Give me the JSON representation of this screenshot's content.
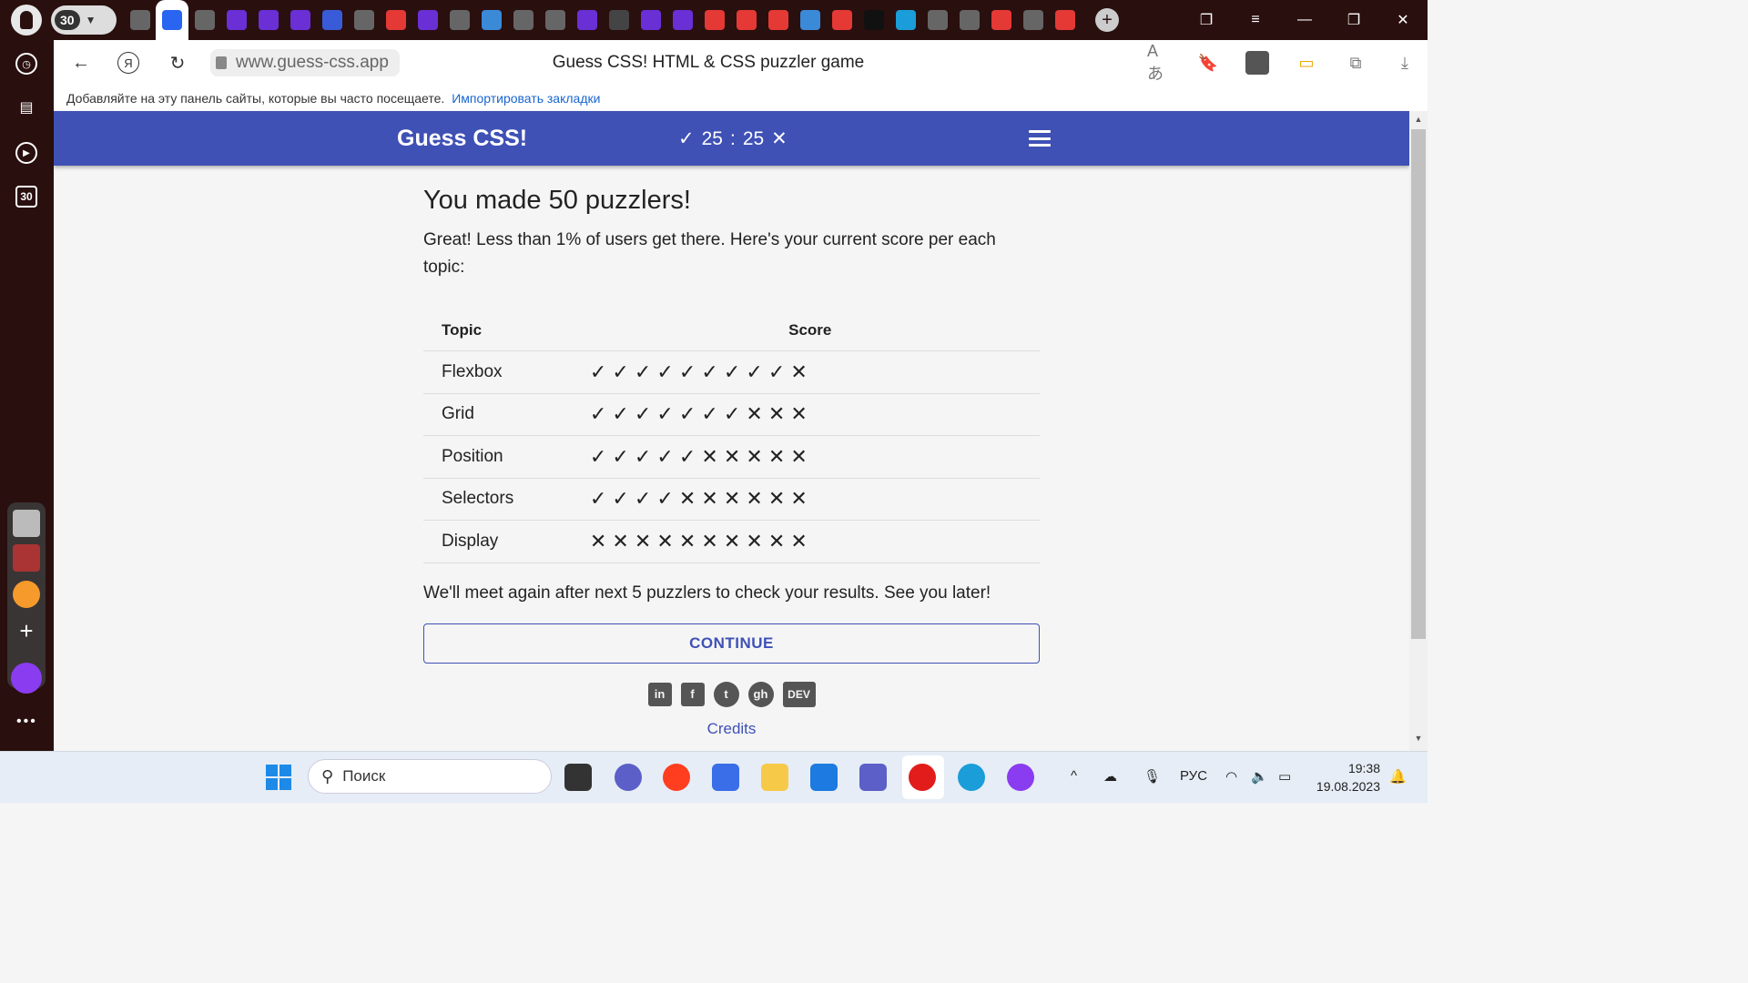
{
  "browser": {
    "tab_group_count": "30",
    "tab_icons": [
      "bookmark-tab-icon",
      "css3-tab-icon",
      "doc-tab-icon",
      "b-tab-icon",
      "b-tab-icon",
      "b-tab-icon",
      "network-tab-icon",
      "dash-tab-icon",
      "yandex-tab-icon",
      "b-tab-icon",
      "doc-tab-icon",
      "puzzle-tab-icon",
      "chart-tab-icon",
      "chart-tab-icon",
      "b-tab-icon",
      "github-tab-icon",
      "b-tab-icon",
      "b-tab-icon",
      "yandex-tab-icon",
      "als-tab-icon",
      "yandex-tab-icon",
      "puzzle-tab-icon",
      "yandex-tab-icon",
      "dev-tab-icon",
      "w-tab-icon",
      "doc-tab-icon",
      "notion-tab-icon",
      "youtube-tab-icon",
      "circle-tab-icon",
      "yandex-tab-icon"
    ],
    "sidebar_counter": "30",
    "url": "www.guess-css.app",
    "page_title": "Guess CSS! HTML & CSS puzzler game",
    "bookmarks_hint": "Добавляйте на эту панель сайты, которые вы часто посещаете.",
    "bookmarks_import": "Импортировать закладки"
  },
  "app": {
    "title": "Guess CSS!",
    "correct_count": "25",
    "separator": ":",
    "wrong_count": "25"
  },
  "content": {
    "heading": "You made 50 puzzlers!",
    "intro": "Great! Less than 1% of users get there. Here's your current score per each topic:",
    "table_headers": {
      "topic": "Topic",
      "score": "Score"
    },
    "rows": [
      {
        "topic": "Flexbox",
        "marks": [
          "✓",
          "✓",
          "✓",
          "✓",
          "✓",
          "✓",
          "✓",
          "✓",
          "✓",
          "✕"
        ]
      },
      {
        "topic": "Grid",
        "marks": [
          "✓",
          "✓",
          "✓",
          "✓",
          "✓",
          "✓",
          "✓",
          "✕",
          "✕",
          "✕"
        ]
      },
      {
        "topic": "Position",
        "marks": [
          "✓",
          "✓",
          "✓",
          "✓",
          "✓",
          "✕",
          "✕",
          "✕",
          "✕",
          "✕"
        ]
      },
      {
        "topic": "Selectors",
        "marks": [
          "✓",
          "✓",
          "✓",
          "✓",
          "✕",
          "✕",
          "✕",
          "✕",
          "✕",
          "✕"
        ]
      },
      {
        "topic": "Display",
        "marks": [
          "✕",
          "✕",
          "✕",
          "✕",
          "✕",
          "✕",
          "✕",
          "✕",
          "✕",
          "✕"
        ]
      }
    ],
    "outro": "We'll meet again after next 5 puzzlers to check your results. See you later!",
    "continue_label": "CONTINUE",
    "social": [
      "in",
      "f",
      "t",
      "gh",
      "DEV"
    ],
    "credits": "Credits"
  },
  "taskbar": {
    "search_placeholder": "Поиск",
    "lang": "РУС",
    "time": "19:38",
    "date": "19.08.2023"
  },
  "colors": {
    "header": "#3f51b5",
    "accent": "#3f51b5",
    "browser_frame": "#2a0f0f"
  }
}
